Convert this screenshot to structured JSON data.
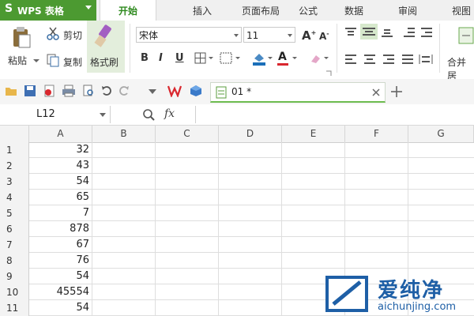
{
  "app": {
    "name": "WPS 表格",
    "logo_letter": "S"
  },
  "menu_tabs": [
    "开始",
    "插入",
    "页面布局",
    "公式",
    "数据",
    "审阅",
    "视图"
  ],
  "ribbon": {
    "paste": "粘贴",
    "cut": "剪切",
    "copy": "复制",
    "format_painter": "格式刷",
    "font_name": "宋体",
    "font_size": "11",
    "grow_font": "A",
    "shrink_font": "A",
    "bold": "B",
    "italic": "I",
    "underline": "U",
    "font_color": "A",
    "merge_center": "合并居"
  },
  "document_tab": {
    "name": "01 *"
  },
  "formula_bar": {
    "cell_ref": "L12",
    "fx": "fx"
  },
  "columns": [
    "A",
    "B",
    "C",
    "D",
    "E",
    "F",
    "G"
  ],
  "rows": [
    {
      "num": "1",
      "a": "32"
    },
    {
      "num": "2",
      "a": "43"
    },
    {
      "num": "3",
      "a": "54"
    },
    {
      "num": "4",
      "a": "65"
    },
    {
      "num": "5",
      "a": "7"
    },
    {
      "num": "6",
      "a": "878"
    },
    {
      "num": "7",
      "a": "67"
    },
    {
      "num": "8",
      "a": "76"
    },
    {
      "num": "9",
      "a": "54"
    },
    {
      "num": "10",
      "a": "45554"
    },
    {
      "num": "11",
      "a": "54"
    }
  ],
  "watermark": {
    "title": "爱纯净",
    "url": "aichunjing.com"
  },
  "colors": {
    "brand_green": "#4c9a31",
    "active_tab_text": "#2f8a1f"
  }
}
